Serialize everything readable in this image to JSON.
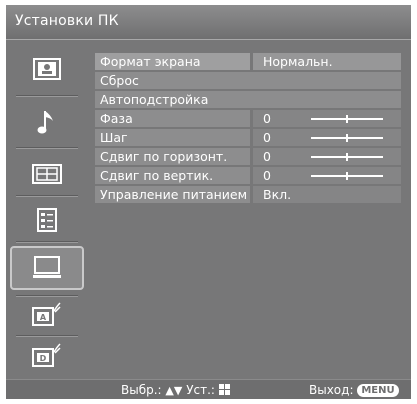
{
  "title": "Установки ПК",
  "sidebar": {
    "items": [
      {
        "icon": "picture-icon"
      },
      {
        "icon": "sound-icon"
      },
      {
        "icon": "screen-icon"
      },
      {
        "icon": "setup-icon"
      },
      {
        "icon": "pc-icon",
        "selected": true
      },
      {
        "icon": "analog-channel-icon"
      },
      {
        "icon": "digital-channel-icon"
      }
    ]
  },
  "menu": {
    "rows": [
      {
        "label": "Формат экрана",
        "value": "Нормальн."
      },
      {
        "label": "Сброс"
      },
      {
        "label": "Автоподстройка"
      },
      {
        "label": "Фаза",
        "value": "0",
        "level": 0.5
      },
      {
        "label": "Шаг",
        "value": "0",
        "level": 0.5
      },
      {
        "label": "Сдвиг по горизонт.",
        "value": "0",
        "level": 0.5
      },
      {
        "label": "Сдвиг по вертик.",
        "value": "0",
        "level": 0.5
      },
      {
        "label": "Управление питанием",
        "value": "Вкл."
      }
    ]
  },
  "footer": {
    "select_label": "Выбр.:",
    "set_label": "Уст.:",
    "exit_label": "Выход:",
    "menu_button": "MENU"
  }
}
